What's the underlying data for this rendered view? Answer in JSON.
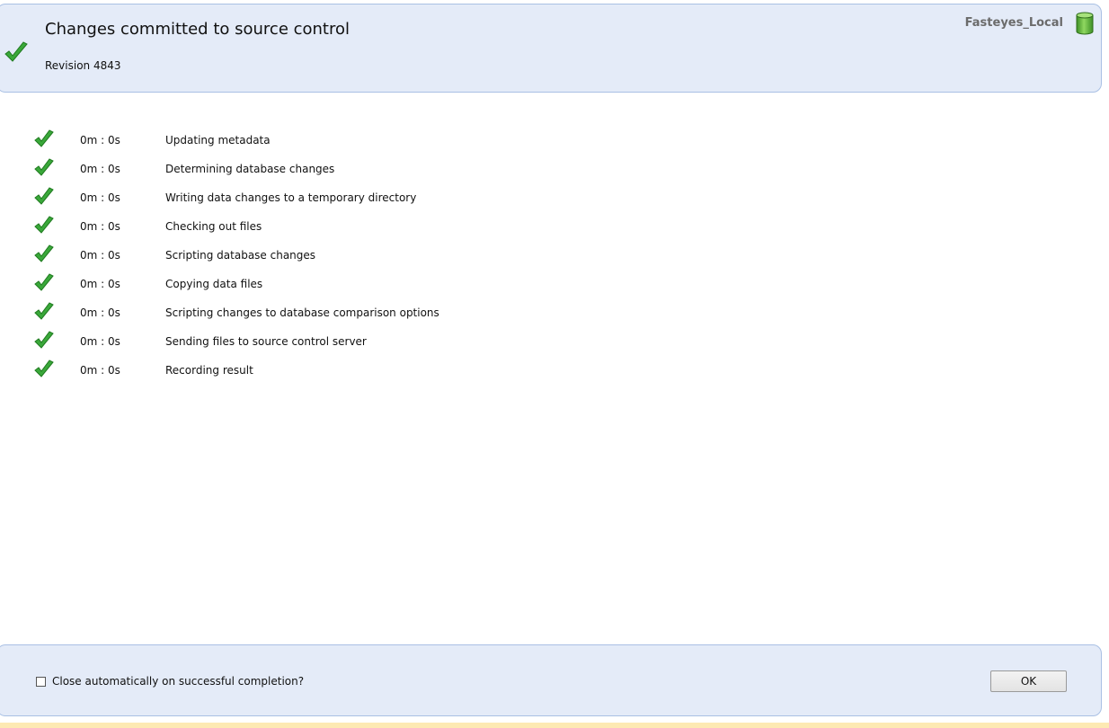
{
  "header": {
    "title": "Changes committed to source control",
    "revision": "Revision 4843",
    "database_name": "Fasteyes_Local"
  },
  "steps": [
    {
      "time": "0m : 0s",
      "label": "Updating metadata"
    },
    {
      "time": "0m : 0s",
      "label": "Determining database changes"
    },
    {
      "time": "0m : 0s",
      "label": "Writing data changes to a temporary directory"
    },
    {
      "time": "0m : 0s",
      "label": "Checking out files"
    },
    {
      "time": "0m : 0s",
      "label": "Scripting database changes"
    },
    {
      "time": "0m : 0s",
      "label": "Copying data files"
    },
    {
      "time": "0m : 0s",
      "label": "Scripting changes to database comparison options"
    },
    {
      "time": "0m : 0s",
      "label": "Sending files to source control server"
    },
    {
      "time": "0m : 0s",
      "label": "Recording result"
    }
  ],
  "footer": {
    "auto_close_label": "Close automatically on successful completion?",
    "auto_close_checked": false,
    "ok_label": "OK"
  },
  "icons": {
    "success": "checkmark-icon",
    "database": "database-cylinder-icon"
  },
  "colors": {
    "panel_bg": "#e4ebf8",
    "panel_border": "#a9c0e4",
    "check_green": "#3aa83a",
    "db_green": "#5fb03a",
    "bottom_strip": "#fde9b3"
  }
}
